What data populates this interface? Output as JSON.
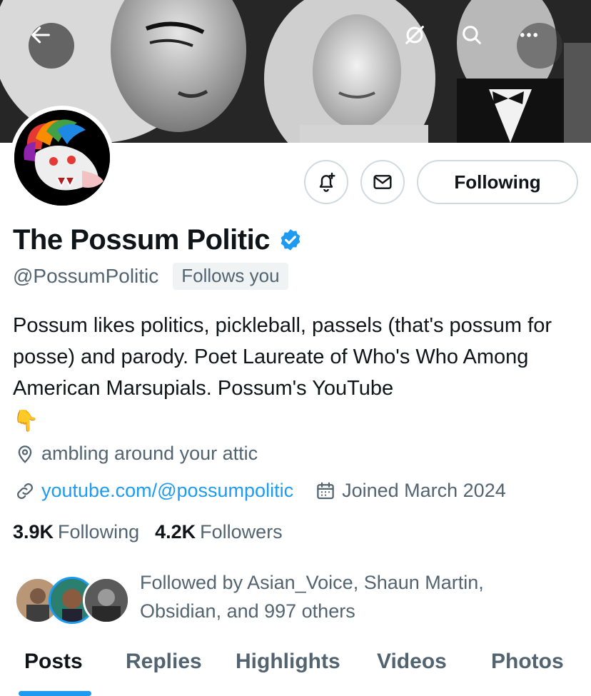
{
  "banner": {
    "back_icon": "arrow-left-icon",
    "private_icon": "circle-slash-icon",
    "search_icon": "search-icon",
    "more_icon": "more-dots-icon"
  },
  "profile": {
    "display_name": "The Possum Politic",
    "verified": true,
    "handle": "@PossumPolitic",
    "follows_you": "Follows you",
    "bio": "Possum likes politics, pickleball, passels (that's possum for posse) and parody. Poet Laureate of Who's Who Among American Marsupials. Possum's YouTube",
    "bio_emoji": "👇",
    "location": "ambling around your attic",
    "website": "youtube.com/@possumpolitic",
    "joined": "Joined March 2024"
  },
  "actions": {
    "notify_icon": "bell-plus-icon",
    "message_icon": "envelope-icon",
    "following_label": "Following"
  },
  "stats": {
    "following_count": "3.9K",
    "following_label": "Following",
    "followers_count": "4.2K",
    "followers_label": "Followers"
  },
  "followed_by": {
    "text": "Followed by Asian_Voice, Shaun Martin, Obsidian, and 997 others"
  },
  "tabs": [
    {
      "label": "Posts",
      "active": true
    },
    {
      "label": "Replies",
      "active": false
    },
    {
      "label": "Highlights",
      "active": false
    },
    {
      "label": "Videos",
      "active": false
    },
    {
      "label": "Photos",
      "active": false
    }
  ],
  "colors": {
    "accent": "#1d9bf0",
    "text_primary": "#0f1419",
    "text_secondary": "#536471",
    "border": "#cfd9de"
  }
}
